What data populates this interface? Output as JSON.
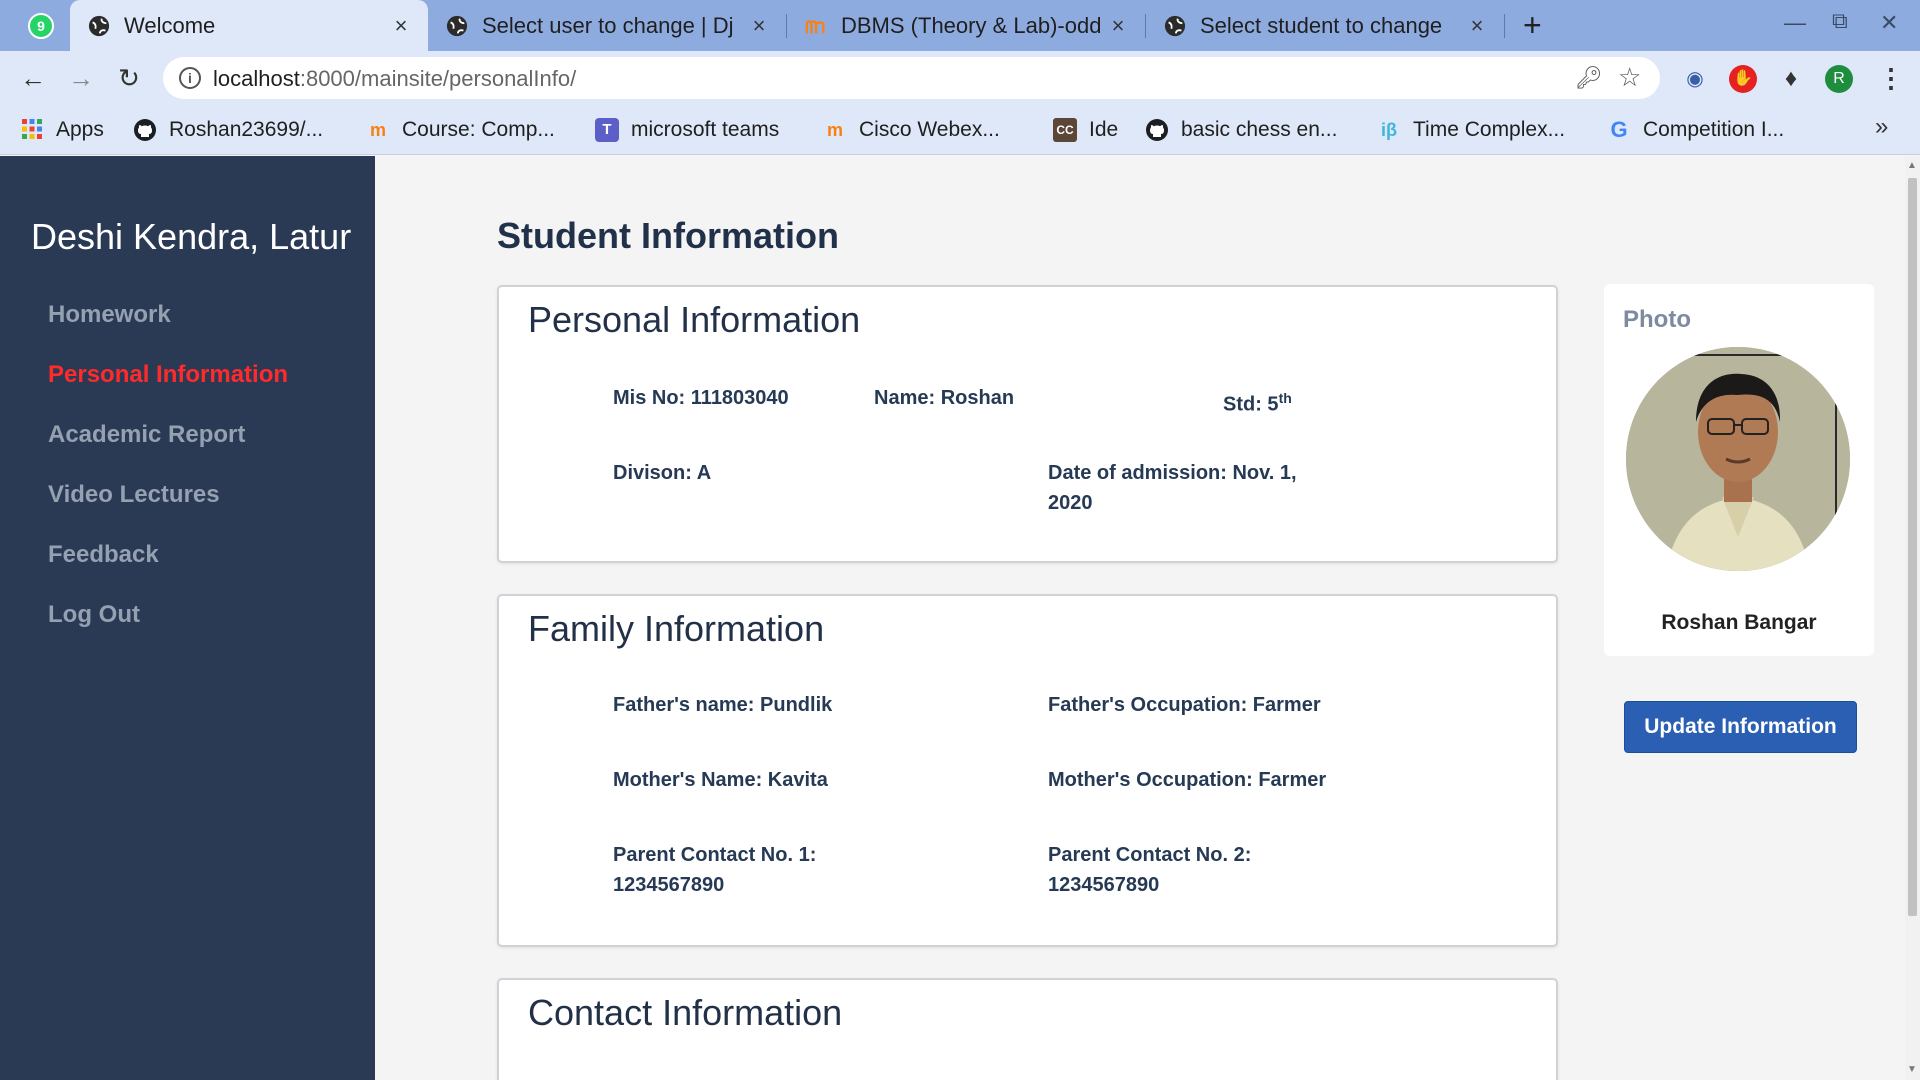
{
  "browser": {
    "whatsapp_badge": "9",
    "tabs": [
      {
        "label": "Welcome",
        "active": true
      },
      {
        "label": "Select user to change | Dj"
      },
      {
        "label": "DBMS (Theory & Lab)-odd"
      },
      {
        "label": "Select student to change"
      }
    ],
    "new_tab": "+",
    "close_glyph": "×",
    "url_host": "localhost",
    "url_rest": ":8000/mainsite/personalInfo/",
    "profile_initial": "R",
    "bookmarks": [
      {
        "label": "Apps",
        "icon": "apps-grid-icon"
      },
      {
        "label": "Roshan23699/...",
        "icon": "github-icon"
      },
      {
        "label": "Course: Comp...",
        "icon": "moodle-icon"
      },
      {
        "label": "microsoft teams",
        "icon": "teams-icon"
      },
      {
        "label": "Cisco Webex...",
        "icon": "moodle-icon"
      },
      {
        "label": "Ide",
        "icon": "codechef-icon"
      },
      {
        "label": "basic chess en...",
        "icon": "github-icon"
      },
      {
        "label": "Time Complex...",
        "icon": "interviewbit-icon"
      },
      {
        "label": "Competition I...",
        "icon": "google-icon"
      }
    ],
    "more_bookmarks": "»"
  },
  "sidebar": {
    "brand": "Deshi Kendra, Latur",
    "items": [
      {
        "label": "Homework"
      },
      {
        "label": "Personal Information",
        "active": true
      },
      {
        "label": "Academic Report"
      },
      {
        "label": "Video Lectures"
      },
      {
        "label": "Feedback"
      },
      {
        "label": "Log Out"
      }
    ]
  },
  "main": {
    "title": "Student Information",
    "personal": {
      "title": "Personal Information",
      "mis": "Mis No: 111803040",
      "name": "Name: Roshan",
      "std": "Std: 5",
      "std_sup": "th",
      "division": "Divison: A",
      "admission_line1": "Date of admission: Nov. 1,",
      "admission_line2": "2020"
    },
    "family": {
      "title": "Family Information",
      "father_name": "Father's name: Pundlik",
      "father_occupation": "Father's Occupation: Farmer",
      "mother_name": "Mother's Name: Kavita",
      "mother_occupation": "Mother's Occupation: Farmer",
      "contact1_label": "Parent Contact No. 1:",
      "contact1_value": "1234567890",
      "contact2_label": "Parent Contact No. 2:",
      "contact2_value": "1234567890"
    },
    "contact": {
      "title": "Contact Information"
    },
    "photo": {
      "label": "Photo",
      "name": "Roshan Bangar"
    },
    "update_button": "Update Information"
  },
  "colors": {
    "sidebar_bg": "#2a3a55",
    "active_nav": "#ff2b2b",
    "button_bg": "#2a5fb4",
    "tabstrip_bg": "#8eabe0"
  }
}
